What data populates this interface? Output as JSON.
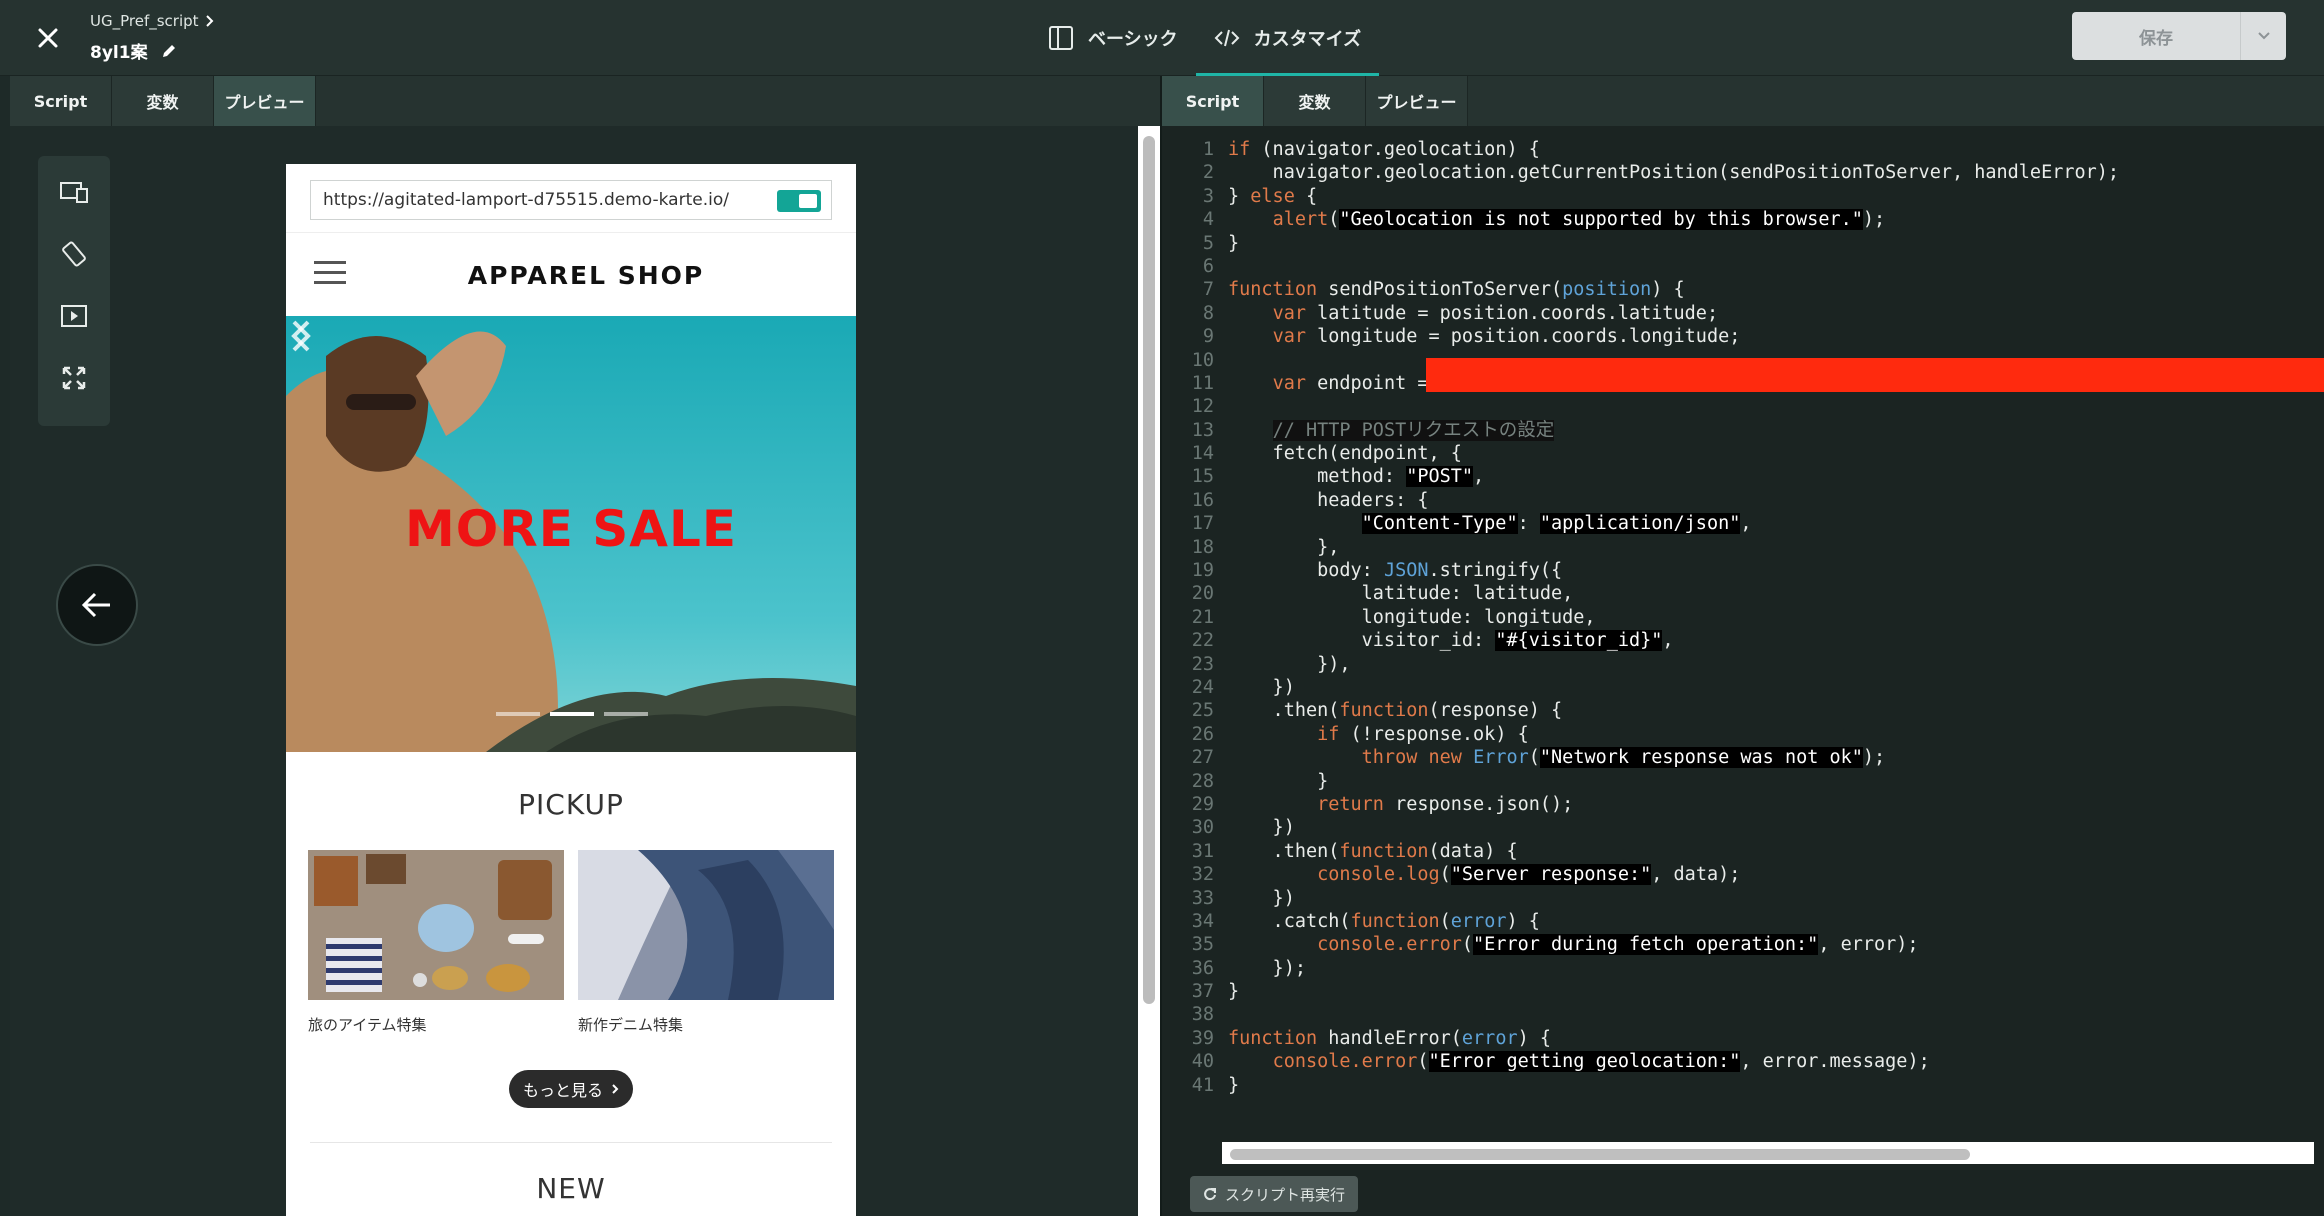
{
  "header": {
    "close_icon": "close-icon",
    "script_name": "UG_Pref_script",
    "variant_name": "8yl1案",
    "mode_tabs": [
      {
        "label": "ベーシック",
        "icon": "layout-icon"
      },
      {
        "label": "カスタマイズ",
        "icon": "code-icon"
      }
    ],
    "save_label": "保存"
  },
  "tabs": [
    "Script",
    "変数",
    "プレビュー"
  ],
  "left_active_tab": "プレビュー",
  "right_active_tab": "Script",
  "tools": [
    "devices-icon",
    "rotate-icon",
    "play-icon",
    "fullscreen-icon"
  ],
  "preview": {
    "url": "https://agitated-lamport-d75515.demo-karte.io/",
    "shop_title": "APPAREL SHOP",
    "hero_text": "MORE SALE",
    "pickup_title": "PICKUP",
    "pickups": [
      "旅のアイテム特集",
      "新作デニム特集"
    ],
    "more_label": "もっと見る",
    "new_title": "NEW"
  },
  "editor": {
    "lines": [
      "if (navigator.geolocation) {",
      "    navigator.geolocation.getCurrentPosition(sendPositionToServer, handleError);",
      "} else {",
      "    alert(\"Geolocation is not supported by this browser.\");",
      "}",
      "",
      "function sendPositionToServer(position) {",
      "    var latitude = position.coords.latitude;",
      "    var longitude = position.coords.longitude;",
      "",
      "    var endpoint =",
      "",
      "    // HTTP POSTリクエストの設定",
      "    fetch(endpoint, {",
      "        method: \"POST\",",
      "        headers: {",
      "            \"Content-Type\": \"application/json\",",
      "        },",
      "        body: JSON.stringify({",
      "            latitude: latitude,",
      "            longitude: longitude,",
      "            visitor_id: \"#{visitor_id}\",",
      "        }),",
      "    })",
      "    .then(function(response) {",
      "        if (!response.ok) {",
      "            throw new Error(\"Network response was not ok\");",
      "        }",
      "        return response.json();",
      "    })",
      "    .then(function(data) {",
      "        console.log(\"Server response:\", data);",
      "    })",
      "    .catch(function(error) {",
      "        console.error(\"Error during fetch operation:\", error);",
      "    });",
      "}",
      "",
      "function handleError(error) {",
      "    console.error(\"Error getting geolocation:\", error.message);",
      "}"
    ],
    "highlighted_line": 34,
    "rerun_label": "スクリプト再実行"
  },
  "colors": {
    "accent": "#1fb5a7",
    "sale_red": "#ee1414",
    "redaction": "#ff2a0e",
    "keyword": "#e07a4a",
    "builtin": "#5fa3d8"
  }
}
